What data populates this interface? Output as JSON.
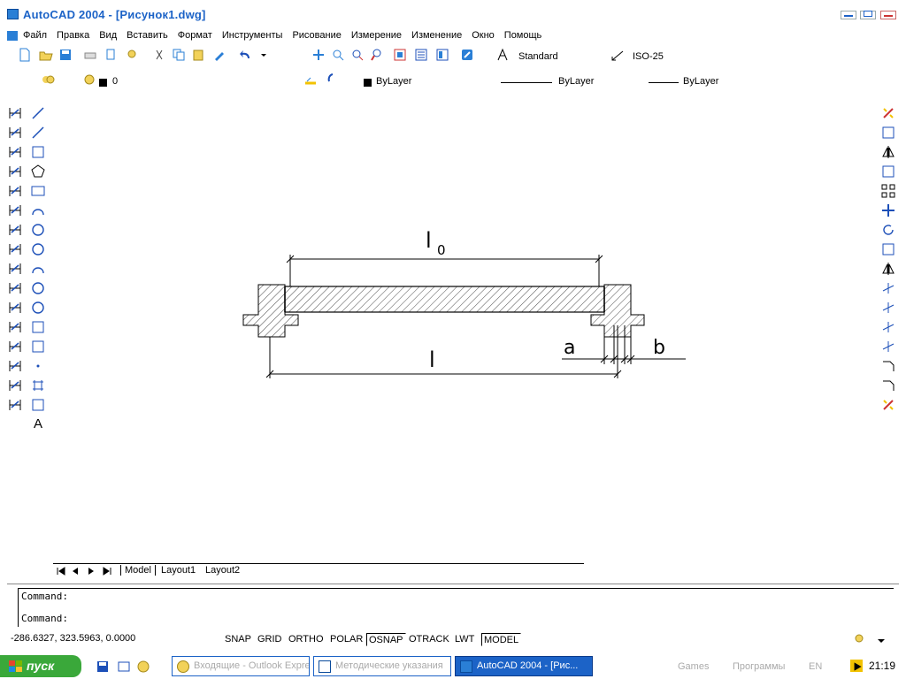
{
  "window": {
    "title": "AutoCAD 2004 - [Рисунок1.dwg]"
  },
  "menu": [
    "Файл",
    "Правка",
    "Вид",
    "Вставить",
    "Формат",
    "Инструменты",
    "Рисование",
    "Измерение",
    "Изменение",
    "Окно",
    "Помощь"
  ],
  "styles_toolbar": {
    "text_style": "Standard",
    "dim_style": "ISO-25"
  },
  "layers_toolbar": {
    "current_layer": "0"
  },
  "properties_toolbar": {
    "color": "ByLayer",
    "linetype": "ByLayer",
    "lineweight": "ByLayer"
  },
  "left_toolbar_icons": [
    "linear-dimension-icon",
    "aligned-dimension-icon",
    "ordinate-dimension-icon",
    "radius-dimension-icon",
    "diameter-dimension-icon",
    "angular-dimension-icon",
    "quick-dimension-icon",
    "baseline-dimension-icon",
    "continue-dimension-icon",
    "quick-leader-icon",
    "tolerance-icon",
    "center-mark-icon",
    "dimension-edit-icon",
    "dimension-text-edit-icon",
    "dimension-update-icon",
    "dimension-style-icon"
  ],
  "draw_toolbar_icons": [
    "line-icon",
    "construction-line-icon",
    "polyline-icon",
    "polygon-icon",
    "rectangle-icon",
    "arc-icon",
    "circle-icon",
    "revision-cloud-icon",
    "spline-icon",
    "ellipse-icon",
    "ellipse-arc-icon",
    "insert-block-icon",
    "make-block-icon",
    "point-icon",
    "hatch-icon",
    "region-icon",
    "multiline-text-icon"
  ],
  "draw_toolbar_letter": "A",
  "modify_toolbar_icons": [
    "erase-icon",
    "copy-icon",
    "mirror-icon",
    "offset-icon",
    "array-icon",
    "move-icon",
    "rotate-icon",
    "scale-icon",
    "stretch-icon",
    "trim-icon",
    "extend-icon",
    "break-icon",
    "break-at-point-icon",
    "chamfer-icon",
    "fillet-icon",
    "explode-icon"
  ],
  "drawing": {
    "dim_top_label": "l",
    "dim_top_subscript": "0",
    "dim_bottom_label": "l",
    "dim_a_label": "a",
    "dim_b_label": "b"
  },
  "tabs": [
    "Model",
    "Layout1",
    "Layout2"
  ],
  "command": {
    "line1": "Command:",
    "line2": "Command:"
  },
  "status": {
    "coordinates": "-286.6327, 323.5963, 0.0000",
    "buttons": [
      {
        "label": "SNAP",
        "on": false
      },
      {
        "label": "GRID",
        "on": false
      },
      {
        "label": "ORTHO",
        "on": false
      },
      {
        "label": "POLAR",
        "on": false
      },
      {
        "label": "OSNAP",
        "on": true
      },
      {
        "label": "OTRACK",
        "on": false
      },
      {
        "label": "LWT",
        "on": false
      },
      {
        "label": "MODEL",
        "on": true
      }
    ]
  },
  "taskbar": {
    "start_label": "пуск",
    "tasks": [
      {
        "label": "Входящие - Outlook Express",
        "active": false
      },
      {
        "label": "Методические указания",
        "active": false
      },
      {
        "label": "AutoCAD 2004 - [Рис...",
        "active": true
      }
    ],
    "tray_items": [
      "Games",
      "Программы",
      "EN"
    ],
    "clock": "21:19"
  }
}
